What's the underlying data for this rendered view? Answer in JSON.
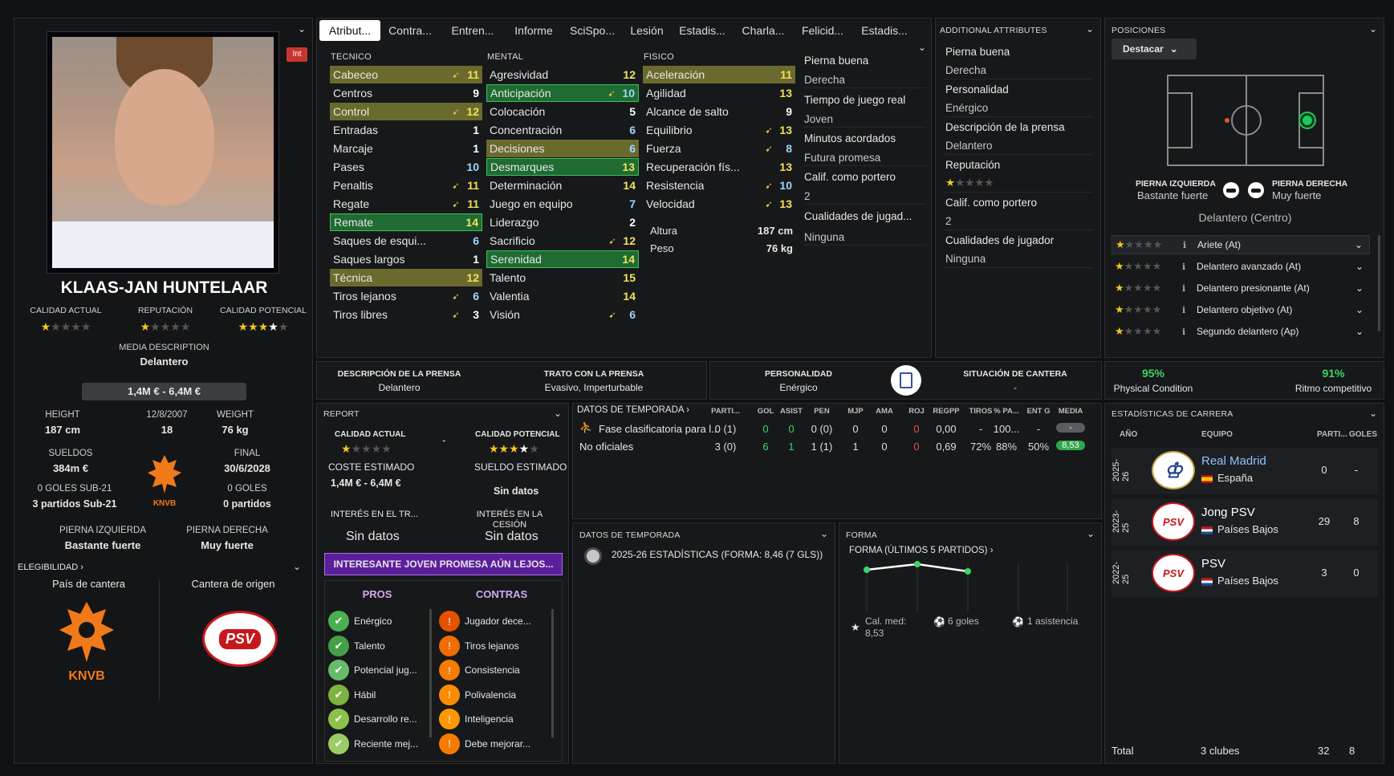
{
  "player": {
    "name": "KLAAS-JAN HUNTELAAR",
    "int_badge": "Int"
  },
  "left": {
    "labels": {
      "current": "CALIDAD ACTUAL",
      "reputation": "REPUTACIÓN",
      "potential": "CALIDAD POTENCIAL",
      "media_desc": "MEDIA DESCRIPTION",
      "height": "HEIGHT",
      "dob": "12/8/2007",
      "weight": "WEIGHT",
      "wages": "SUELDOS",
      "end": "FINAL",
      "left_foot": "PIERNA IZQUIERDA",
      "right_foot": "PIERNA DERECHA",
      "eligibility": "ELEGIBILIDAD",
      "country": "País de cantera",
      "club": "Cantera de origen",
      "knvb": "KNVB"
    },
    "media_desc": "Delantero",
    "value": "1,4M € - 6,4M €",
    "height": "187 cm",
    "age": "18",
    "weight": "76 kg",
    "wages": "384m €",
    "end_date": "30/6/2028",
    "u21_goals": "0 GOLES SUB-21",
    "u21_apps": "3 partidos Sub-21",
    "goals": "0 GOLES",
    "apps": "0 partidos",
    "left_foot": "Bastante fuerte",
    "right_foot": "Muy fuerte",
    "ratings": {
      "current": 1,
      "reputation": 1,
      "potential": 3.5
    }
  },
  "tabs": [
    "Atribut...",
    "Contra...",
    "Entren...",
    "Informe",
    "SciSpo...",
    "Lesión",
    "Estadis...",
    "Charla...",
    "Felicid...",
    "Estadis..."
  ],
  "attributes": {
    "tecnico_label": "TECNICO",
    "mental_label": "MENTAL",
    "fisico_label": "FISICO",
    "tecnico": [
      {
        "n": "Cabeceo",
        "v": "11",
        "hl": "y",
        "arr": true,
        "c": "y"
      },
      {
        "n": "Centros",
        "v": "9",
        "hl": "",
        "arr": false,
        "c": "w"
      },
      {
        "n": "Control",
        "v": "12",
        "hl": "y",
        "arr": true,
        "c": "y"
      },
      {
        "n": "Entradas",
        "v": "1",
        "hl": "",
        "arr": false,
        "c": "w"
      },
      {
        "n": "Marcaje",
        "v": "1",
        "hl": "",
        "arr": false,
        "c": "w"
      },
      {
        "n": "Pases",
        "v": "10",
        "hl": "",
        "arr": false,
        "c": "c"
      },
      {
        "n": "Penaltis",
        "v": "11",
        "hl": "",
        "arr": true,
        "c": "y"
      },
      {
        "n": "Regate",
        "v": "11",
        "hl": "",
        "arr": true,
        "c": "y"
      },
      {
        "n": "Remate",
        "v": "14",
        "hl": "g",
        "arr": false,
        "c": "y"
      },
      {
        "n": "Saques de esqui...",
        "v": "6",
        "hl": "",
        "arr": false,
        "c": "c"
      },
      {
        "n": "Saques largos",
        "v": "1",
        "hl": "",
        "arr": false,
        "c": "w"
      },
      {
        "n": "Técnica",
        "v": "12",
        "hl": "y",
        "arr": false,
        "c": "y"
      },
      {
        "n": "Tiros lejanos",
        "v": "6",
        "hl": "",
        "arr": true,
        "c": "c"
      },
      {
        "n": "Tiros libres",
        "v": "3",
        "hl": "",
        "arr": true,
        "c": "w"
      }
    ],
    "mental": [
      {
        "n": "Agresividad",
        "v": "12",
        "hl": "",
        "arr": false,
        "c": "y"
      },
      {
        "n": "Anticipación",
        "v": "10",
        "hl": "g",
        "arr": true,
        "c": "c"
      },
      {
        "n": "Colocación",
        "v": "5",
        "hl": "",
        "arr": false,
        "c": "w"
      },
      {
        "n": "Concentración",
        "v": "6",
        "hl": "",
        "arr": false,
        "c": "c"
      },
      {
        "n": "Decisiones",
        "v": "6",
        "hl": "y",
        "arr": false,
        "c": "c"
      },
      {
        "n": "Desmarques",
        "v": "13",
        "hl": "g",
        "arr": false,
        "c": "y"
      },
      {
        "n": "Determinación",
        "v": "14",
        "hl": "",
        "arr": false,
        "c": "y"
      },
      {
        "n": "Juego en equipo",
        "v": "7",
        "hl": "",
        "arr": false,
        "c": "c"
      },
      {
        "n": "Liderazgo",
        "v": "2",
        "hl": "",
        "arr": false,
        "c": "w"
      },
      {
        "n": "Sacrificio",
        "v": "12",
        "hl": "",
        "arr": true,
        "c": "y"
      },
      {
        "n": "Serenidad",
        "v": "14",
        "hl": "g",
        "arr": false,
        "c": "y"
      },
      {
        "n": "Talento",
        "v": "15",
        "hl": "",
        "arr": false,
        "c": "y"
      },
      {
        "n": "Valentia",
        "v": "14",
        "hl": "",
        "arr": false,
        "c": "y"
      },
      {
        "n": "Visión",
        "v": "6",
        "hl": "",
        "arr": true,
        "c": "c"
      }
    ],
    "fisico": [
      {
        "n": "Aceleración",
        "v": "11",
        "hl": "y",
        "arr": false,
        "c": "y"
      },
      {
        "n": "Agilidad",
        "v": "13",
        "hl": "",
        "arr": false,
        "c": "y"
      },
      {
        "n": "Alcance de salto",
        "v": "9",
        "hl": "",
        "arr": false,
        "c": "w"
      },
      {
        "n": "Equilibrio",
        "v": "13",
        "hl": "",
        "arr": true,
        "c": "y"
      },
      {
        "n": "Fuerza",
        "v": "8",
        "hl": "",
        "arr": true,
        "c": "c"
      },
      {
        "n": "Recuperación fís...",
        "v": "13",
        "hl": "",
        "arr": false,
        "c": "y"
      },
      {
        "n": "Resistencia",
        "v": "10",
        "hl": "",
        "arr": true,
        "c": "c"
      },
      {
        "n": "Velocidad",
        "v": "13",
        "hl": "",
        "arr": true,
        "c": "y"
      }
    ],
    "altura_label": "Altura",
    "altura": "187 cm",
    "peso_label": "Peso",
    "peso": "76 kg",
    "side": [
      {
        "t": "Pierna buena",
        "s": false
      },
      {
        "t": "Derecha",
        "s": true
      },
      {
        "t": "Tiempo de juego real",
        "s": false
      },
      {
        "t": "Joven",
        "s": true
      },
      {
        "t": "Minutos acordados",
        "s": false
      },
      {
        "t": "Futura promesa",
        "s": true
      },
      {
        "t": "Calif. como portero",
        "s": false
      },
      {
        "t": "2",
        "s": true
      },
      {
        "t": "Cualidades de jugad...",
        "s": false
      },
      {
        "t": "Ninguna",
        "s": true
      }
    ]
  },
  "additional": {
    "title": "ADDITIONAL ATTRIBUTES",
    "items": [
      {
        "t": "Pierna buena",
        "s": false
      },
      {
        "t": "Derecha",
        "s": true
      },
      {
        "t": "Personalidad",
        "s": false
      },
      {
        "t": "Enérgico",
        "s": true
      },
      {
        "t": "Descripción de la prensa",
        "s": false
      },
      {
        "t": "Delantero",
        "s": true
      },
      {
        "t": "Reputación",
        "s": false
      },
      {
        "t": "",
        "s": true,
        "stars": 1
      },
      {
        "t": "Calif. como portero",
        "s": false
      },
      {
        "t": "2",
        "s": true
      },
      {
        "t": "Cualidades de jugador",
        "s": false
      },
      {
        "t": "Ninguna",
        "s": true
      }
    ]
  },
  "positions": {
    "title": "POSICIONES",
    "button": "Destacar",
    "left_foot_label": "PIERNA IZQUIERDA",
    "left_foot": "Bastante fuerte",
    "right_foot_label": "PIERNA DERECHA",
    "right_foot": "Muy fuerte",
    "position": "Delantero (Centro)",
    "roles": [
      {
        "name": "Ariete (At)",
        "stars": 1
      },
      {
        "name": "Delantero avanzado (At)",
        "stars": 1
      },
      {
        "name": "Delantero presionante (At)",
        "stars": 1
      },
      {
        "name": "Delantero objetivo (At)",
        "stars": 1
      },
      {
        "name": "Segundo delantero (Ap)",
        "stars": 1
      }
    ]
  },
  "press": {
    "desc_label": "DESCRIPCIÓN DE LA PRENSA",
    "desc": "Delantero",
    "trato_label": "TRATO CON LA PRENSA",
    "trato": "Evasivo, Imperturbable",
    "pers_label": "PERSONALIDAD",
    "pers": "Enérgico",
    "cantera_label": "SITUACIÓN DE CANTERA",
    "cantera": "-"
  },
  "condition": {
    "physical": "95%",
    "physical_label": "Physical Condition",
    "ritmo": "91%",
    "ritmo_label": "Ritmo competitivo"
  },
  "report": {
    "title": "REPORT",
    "ca_label": "CALIDAD ACTUAL",
    "pa_label": "CALIDAD POTENCIAL",
    "dash": "-",
    "coste_label": "COSTE ESTIMADO",
    "coste": "1,4M € - 6,4M €",
    "sueldo_label": "SUELDO ESTIMADO",
    "sueldo": "Sin datos",
    "int_tr_label": "INTERÉS EN EL TR...",
    "int_tr": "Sin datos",
    "int_ces_label": "INTERÉS EN LA CESIÓN",
    "int_ces": "Sin datos",
    "banner": "INTERESANTE JOVEN PROMESA AÚN LEJOS...",
    "pros_label": "PROS",
    "contras_label": "CONTRAS",
    "pros": [
      "Enérgico",
      "Talento",
      "Potencial jug...",
      "Hábil",
      "Desarrollo re...",
      "Reciente mej..."
    ],
    "contras": [
      "Jugador dece...",
      "Tiros lejanos",
      "Consistencia",
      "Polivalencia",
      "Inteligencia",
      "Debe mejorar..."
    ]
  },
  "season": {
    "title": "DATOS DE TEMPORADA",
    "cols": [
      "PARTI...",
      "GOL",
      "ASIST",
      "PEN",
      "MJP",
      "AMA",
      "ROJ",
      "REGPP",
      "TIROS",
      "% PA...",
      "ENT G",
      "MEDIA"
    ],
    "rows": [
      {
        "name": "Fase clasificatoria para l...",
        "vals": [
          "0 (1)",
          "0",
          "0",
          "0 (0)",
          "0",
          "0",
          "0",
          "0,00",
          "-",
          "100...",
          "-",
          "-"
        ]
      },
      {
        "name": "No oficiales",
        "vals": [
          "3 (0)",
          "6",
          "1",
          "1 (1)",
          "1",
          "0",
          "0",
          "0,69",
          "72%",
          "88%",
          "50%",
          "8,53"
        ]
      }
    ]
  },
  "season2": {
    "title": "DATOS DE TEMPORADA",
    "line": "2025-26 ESTADÍSTICAS (FORMA: 8,46 (7 GLS))"
  },
  "forma": {
    "title": "FORMA",
    "sub": "FORMA (ÚLTIMOS 5 PARTIDOS)",
    "cal_label": "Cal. med:",
    "cal": "8,53",
    "goals": "6 goles",
    "assist": "1 asistencia"
  },
  "career": {
    "title": "ESTADÍSTICAS DE CARRERA",
    "cols": [
      "AÑO",
      "EQUIPO",
      "PARTI...",
      "GOLES"
    ],
    "rows": [
      {
        "year": "2025-26",
        "club": "Real Madrid",
        "country": "España",
        "apps": "0",
        "goals": "-"
      },
      {
        "year": "2023-25",
        "club": "Jong PSV",
        "country": "Países Bajos",
        "apps": "29",
        "goals": "8"
      },
      {
        "year": "2022-25",
        "club": "PSV",
        "country": "Países Bajos",
        "apps": "3",
        "goals": "0"
      }
    ],
    "total_label": "Total",
    "total_clubs": "3 clubes",
    "total_apps": "32",
    "total_goals": "8"
  }
}
